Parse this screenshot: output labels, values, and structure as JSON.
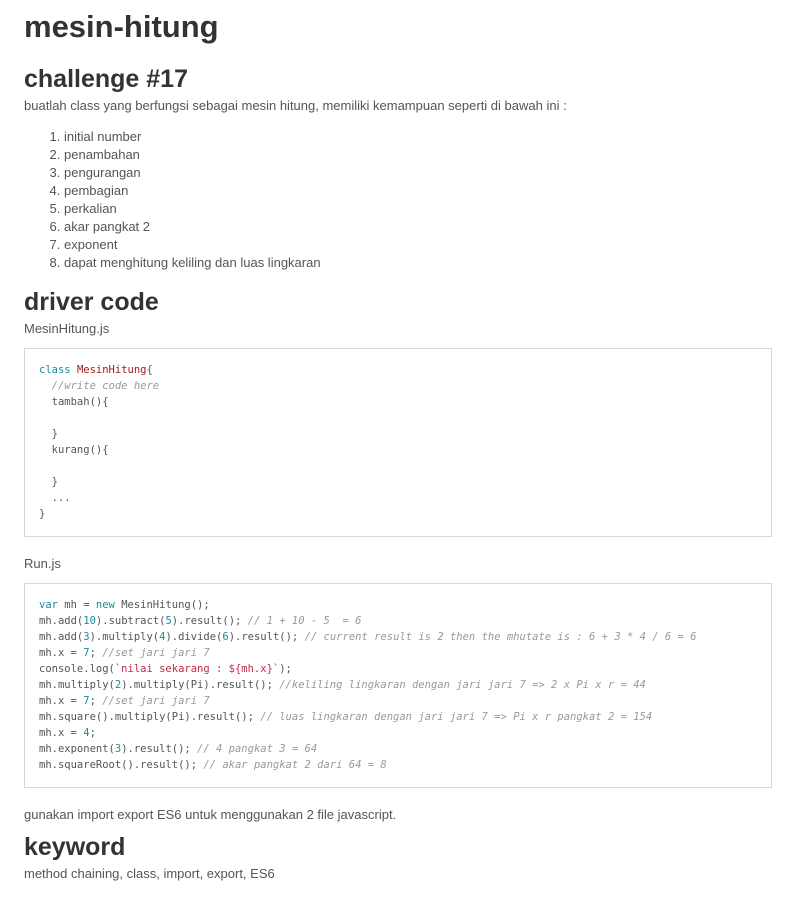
{
  "title": "mesin-hitung",
  "challenge": {
    "heading": "challenge #17",
    "intro": "buatlah class yang berfungsi sebagai mesin hitung, memiliki kemampuan seperti di bawah ini :",
    "items": [
      "initial number",
      "penambahan",
      "pengurangan",
      "pembagian",
      "perkalian",
      "akar pangkat 2",
      "exponent",
      "dapat menghitung keliling dan luas lingkaran"
    ]
  },
  "driver": {
    "heading": "driver code",
    "file1": "MesinHitung.js",
    "code1": {
      "l1_kw": "class",
      "l1_cls": "MesinHitung",
      "l1_rest": "{",
      "l2": "  //write code here",
      "l3": "  tambah(){",
      "l4": "",
      "l5": "  }",
      "l6": "  kurang(){",
      "l7": "",
      "l8": "  }",
      "l9": "  ...",
      "l10": "}"
    },
    "file2": "Run.js",
    "code2": {
      "r1_kw": "var",
      "r1_a": " mh = ",
      "r1_new": "new",
      "r1_b": " MesinHitung();",
      "r2_a": "mh.add(",
      "r2_n1": "10",
      "r2_b": ").subtract(",
      "r2_n2": "5",
      "r2_c": ").result(); ",
      "r2_cm": "// 1 + 10 - 5  = 6",
      "r3_a": "mh.add(",
      "r3_n1": "3",
      "r3_b": ").multiply(",
      "r3_n2": "4",
      "r3_c": ").divide(",
      "r3_n3": "6",
      "r3_d": ").result(); ",
      "r3_cm": "// current result is 2 then the mhutate is : 6 + 3 * 4 / 6 = 6",
      "r4_a": "mh.x = ",
      "r4_n": "7",
      "r4_b": "; ",
      "r4_cm": "//set jari jari 7",
      "r5_a": "console.log(",
      "r5_str": "`nilai sekarang : ${mh.x}`",
      "r5_b": ");",
      "r6_a": "mh.multiply(",
      "r6_n": "2",
      "r6_b": ").multiply(Pi).result(); ",
      "r6_cm": "//keliling lingkaran dengan jari jari 7 => 2 x Pi x r = 44",
      "r7_a": "mh.x = ",
      "r7_n": "7",
      "r7_b": "; ",
      "r7_cm": "//set jari jari 7",
      "r8_a": "mh.square().multiply(Pi).result(); ",
      "r8_cm": "// luas lingkaran dengan jari jari 7 => Pi x r pangkat 2 = 154",
      "r9_a": "mh.x = ",
      "r9_n": "4",
      "r9_b": ";",
      "r10_a": "mh.exponent(",
      "r10_n": "3",
      "r10_b": ").result(); ",
      "r10_cm": "// 4 pangkat 3 = 64",
      "r11_a": "mh.squareRoot().result(); ",
      "r11_cm": "// akar pangkat 2 dari 64 = 8"
    },
    "note": "gunakan import export ES6 untuk menggunakan 2 file javascript."
  },
  "keyword": {
    "heading": "keyword",
    "text": "method chaining, class, import, export, ES6"
  },
  "colors": {
    "heading": "#333333",
    "text": "#555555",
    "keyword": "#1b8a9a",
    "class_name": "#a01a1a",
    "comment": "#999999",
    "string": "#c22a4a",
    "border": "#d8d8d8"
  }
}
